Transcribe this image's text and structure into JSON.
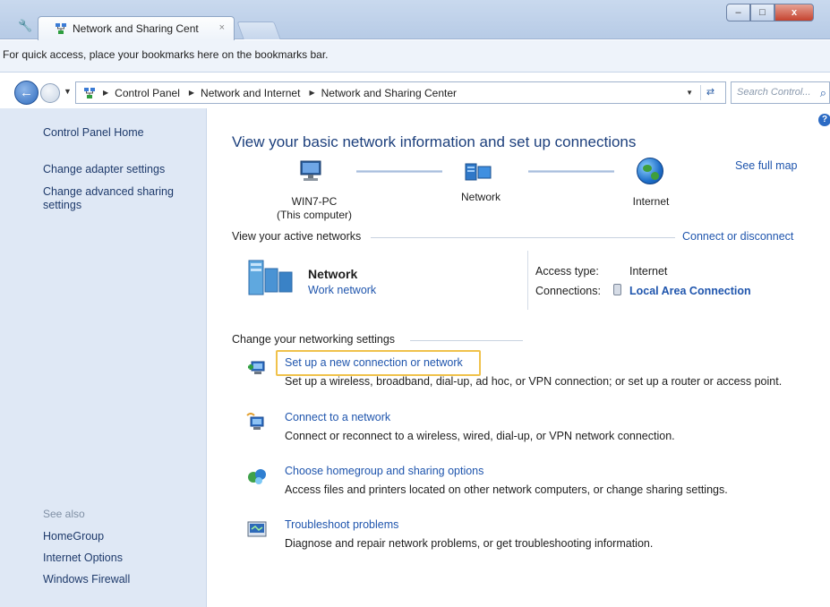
{
  "browser": {
    "tab_title": "Network and Sharing Cent",
    "tab_close": "×",
    "bookmarks_message": "For quick access, place your bookmarks here on the bookmarks bar.",
    "window_buttons": {
      "minimize": "–",
      "maximize": "□",
      "close": "x"
    }
  },
  "address": {
    "breadcrumbs": [
      "Control Panel",
      "Network and Internet",
      "Network and Sharing Center"
    ],
    "search_placeholder": "Search Control...",
    "icons": [
      "back-arrow-icon",
      "forward-arrow-icon",
      "refresh-icon",
      "search-icon"
    ]
  },
  "sidebar": {
    "home": "Control Panel Home",
    "links": [
      "Change adapter settings",
      "Change advanced sharing settings"
    ],
    "see_also_heading": "See also",
    "see_also": [
      "HomeGroup",
      "Internet Options",
      "Windows Firewall"
    ]
  },
  "main": {
    "title": "View your basic network information and set up connections",
    "see_full_map": "See full map",
    "map": {
      "computer_name": "WIN7-PC",
      "computer_sub": "(This computer)",
      "network_label": "Network",
      "internet_label": "Internet"
    },
    "active_networks": {
      "heading": "View your active networks",
      "connect_link": "Connect or disconnect",
      "network_name": "Network",
      "network_type": "Work network",
      "access_type_label": "Access type:",
      "access_type_value": "Internet",
      "connections_label": "Connections:",
      "connections_value": "Local Area Connection"
    },
    "settings": {
      "heading": "Change your networking settings",
      "tasks": [
        {
          "link": "Set up a new connection or network",
          "desc": "Set up a wireless, broadband, dial-up, ad hoc, or VPN connection; or set up a router or access point.",
          "icon": "new-connection-icon"
        },
        {
          "link": "Connect to a network",
          "desc": "Connect or reconnect to a wireless, wired, dial-up, or VPN network connection.",
          "icon": "connect-network-icon"
        },
        {
          "link": "Choose homegroup and sharing options",
          "desc": "Access files and printers located on other network computers, or change sharing settings.",
          "icon": "homegroup-icon"
        },
        {
          "link": "Troubleshoot problems",
          "desc": "Diagnose and repair network problems, or get troubleshooting information.",
          "icon": "troubleshoot-icon"
        }
      ]
    }
  },
  "colors": {
    "link": "#1f55ad",
    "title": "#1c3f7c",
    "sidebar_bg": "#dfe8f5",
    "highlight": "#f0c24b"
  }
}
